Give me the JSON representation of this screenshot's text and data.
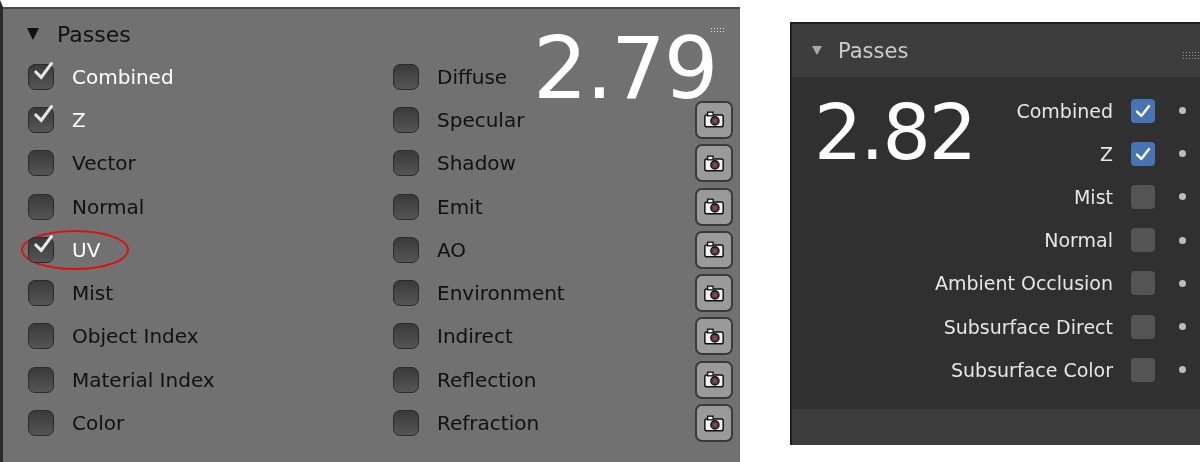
{
  "panel_279": {
    "title": "Passes",
    "expanded": true,
    "version": "2.79",
    "left_column": [
      {
        "label": "Combined",
        "checked": true,
        "circled": false
      },
      {
        "label": "Z",
        "checked": true,
        "circled": false
      },
      {
        "label": "Vector",
        "checked": false,
        "circled": false
      },
      {
        "label": "Normal",
        "checked": false,
        "circled": false
      },
      {
        "label": "UV",
        "checked": true,
        "circled": true
      },
      {
        "label": "Mist",
        "checked": false,
        "circled": false
      },
      {
        "label": "Object Index",
        "checked": false,
        "circled": false
      },
      {
        "label": "Material Index",
        "checked": false,
        "circled": false
      },
      {
        "label": "Color",
        "checked": false,
        "circled": false
      }
    ],
    "right_column": [
      {
        "label": "Diffuse",
        "checked": false,
        "camera_button": false
      },
      {
        "label": "Specular",
        "checked": false,
        "camera_button": true
      },
      {
        "label": "Shadow",
        "checked": false,
        "camera_button": true
      },
      {
        "label": "Emit",
        "checked": false,
        "camera_button": true
      },
      {
        "label": "AO",
        "checked": false,
        "camera_button": true
      },
      {
        "label": "Environment",
        "checked": false,
        "camera_button": true
      },
      {
        "label": "Indirect",
        "checked": false,
        "camera_button": true
      },
      {
        "label": "Reflection",
        "checked": false,
        "camera_button": true
      },
      {
        "label": "Refraction",
        "checked": false,
        "camera_button": true
      }
    ]
  },
  "panel_282": {
    "title": "Passes",
    "expanded": true,
    "version": "2.82",
    "rows": [
      {
        "label": "Combined",
        "checked": true
      },
      {
        "label": "Z",
        "checked": true
      },
      {
        "label": "Mist",
        "checked": false
      },
      {
        "label": "Normal",
        "checked": false
      },
      {
        "label": "Ambient Occlusion",
        "checked": false
      },
      {
        "label": "Subsurface Direct",
        "checked": false
      },
      {
        "label": "Subsurface Color",
        "checked": false
      }
    ]
  }
}
